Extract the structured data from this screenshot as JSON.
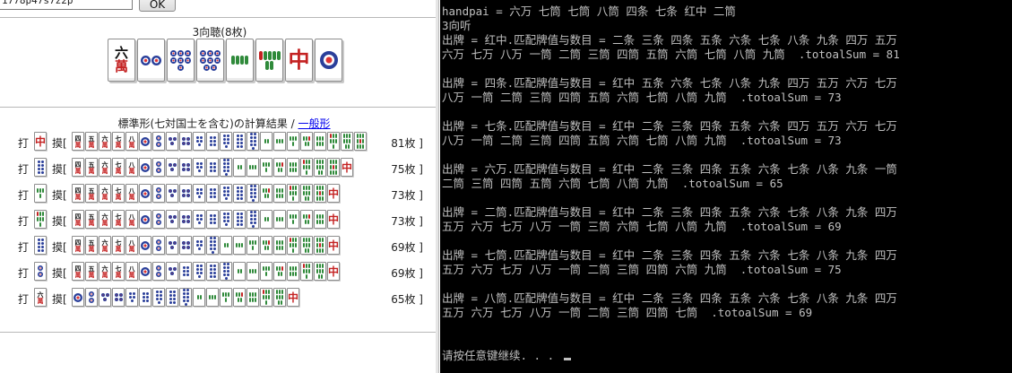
{
  "query": {
    "value": "1778p47s7z2p",
    "button": "OK"
  },
  "hand": {
    "title": "3向聴(8枚)",
    "tiles": [
      "6m",
      "2p",
      "7p",
      "8p",
      "4s",
      "7s",
      "7z",
      "1p"
    ]
  },
  "result": {
    "title_prefix": "標準形(七対国士を含む)の計算結果 / ",
    "link": "一般形",
    "discard_label": "打",
    "draw_label": "摸[",
    "rows": [
      {
        "discard": "7z",
        "draws": [
          "4m",
          "5m",
          "6m",
          "7m",
          "8m",
          "1p",
          "2p",
          "3p",
          "4p",
          "5p",
          "6p",
          "7p",
          "8p",
          "9p",
          "2s",
          "3s",
          "4s",
          "5s",
          "6s",
          "7s",
          "8s",
          "9s"
        ],
        "count": "81枚 ]"
      },
      {
        "discard": "8p",
        "draws": [
          "4m",
          "5m",
          "6m",
          "7m",
          "8m",
          "1p",
          "2p",
          "3p",
          "4p",
          "5p",
          "6p",
          "9p",
          "2s",
          "3s",
          "4s",
          "5s",
          "6s",
          "7s",
          "8s",
          "9s",
          "7z"
        ],
        "count": "75枚 ]"
      },
      {
        "discard": "4s",
        "draws": [
          "4m",
          "5m",
          "6m",
          "7m",
          "8m",
          "1p",
          "2p",
          "3p",
          "4p",
          "5p",
          "6p",
          "7p",
          "8p",
          "9p",
          "5s",
          "6s",
          "7s",
          "8s",
          "9s",
          "7z"
        ],
        "count": "73枚 ]"
      },
      {
        "discard": "7s",
        "draws": [
          "4m",
          "5m",
          "6m",
          "7m",
          "8m",
          "1p",
          "2p",
          "3p",
          "4p",
          "5p",
          "6p",
          "7p",
          "8p",
          "9p",
          "2s",
          "3s",
          "4s",
          "5s",
          "6s",
          "7z"
        ],
        "count": "73枚 ]"
      },
      {
        "discard": "8p",
        "draws": [
          "4m",
          "5m",
          "6m",
          "7m",
          "8m",
          "1p",
          "2p",
          "3p",
          "4p",
          "5p",
          "9p",
          "2s",
          "3s",
          "4s",
          "5s",
          "6s",
          "7s",
          "8s",
          "9s",
          "7z"
        ],
        "count": "69枚 ]"
      },
      {
        "discard": "2p",
        "draws": [
          "4m",
          "5m",
          "6m",
          "7m",
          "8m",
          "1p",
          "2p",
          "3p",
          "6p",
          "7p",
          "8p",
          "9p",
          "2s",
          "3s",
          "4s",
          "5s",
          "6s",
          "7s",
          "8s",
          "7z"
        ],
        "count": "69枚 ]"
      },
      {
        "discard": "6m",
        "draws": [
          "1p",
          "2p",
          "3p",
          "4p",
          "5p",
          "6p",
          "7p",
          "8p",
          "9p",
          "2s",
          "3s",
          "4s",
          "5s",
          "6s",
          "7s",
          "8s",
          "7z"
        ],
        "count": "65枚 ]"
      }
    ]
  },
  "console_lines": [
    "handpai = 六万 七筒 七筒 八筒 四条 七条 红中 二筒",
    "3向听",
    "出牌 = 红中.匹配牌值与数目 = 二条 三条 四条 五条 六条 七条 八条 九条 四万 五万",
    "六万 七万 八万 一筒 二筒 三筒 四筒 五筒 六筒 七筒 八筒 九筒  .totoalSum = 81",
    "",
    "出牌 = 四条.匹配牌值与数目 = 红中 五条 六条 七条 八条 九条 四万 五万 六万 七万",
    "八万 一筒 二筒 三筒 四筒 五筒 六筒 七筒 八筒 九筒  .totoalSum = 73",
    "",
    "出牌 = 七条.匹配牌值与数目 = 红中 二条 三条 四条 五条 六条 四万 五万 六万 七万",
    "八万 一筒 二筒 三筒 四筒 五筒 六筒 七筒 八筒 九筒  .totoalSum = 73",
    "",
    "出牌 = 六万.匹配牌值与数目 = 红中 二条 三条 四条 五条 六条 七条 八条 九条 一筒",
    "二筒 三筒 四筒 五筒 六筒 七筒 八筒 九筒  .totoalSum = 65",
    "",
    "出牌 = 二筒.匹配牌值与数目 = 红中 二条 三条 四条 五条 六条 七条 八条 九条 四万",
    "五万 六万 七万 八万 一筒 三筒 六筒 七筒 八筒 九筒  .totoalSum = 69",
    "",
    "出牌 = 七筒.匹配牌值与数目 = 红中 二条 三条 四条 五条 六条 七条 八条 九条 四万",
    "五万 六万 七万 八万 一筒 二筒 三筒 四筒 六筒 九筒  .totoalSum = 75",
    "",
    "出牌 = 八筒.匹配牌值与数目 = 红中 二条 三条 四条 五条 六条 七条 八条 九条 四万",
    "五万 六万 七万 八万 一筒 二筒 三筒 四筒 七筒  .totoalSum = 69",
    "",
    "",
    "请按任意键继续. . . "
  ],
  "colors": {
    "console_bg": "#000000",
    "console_fg": "#c0c0c0",
    "link": "#0000ee",
    "pin_blue": "#2a3f9a",
    "sou_green": "#2f8a3a",
    "red": "#c42222"
  }
}
